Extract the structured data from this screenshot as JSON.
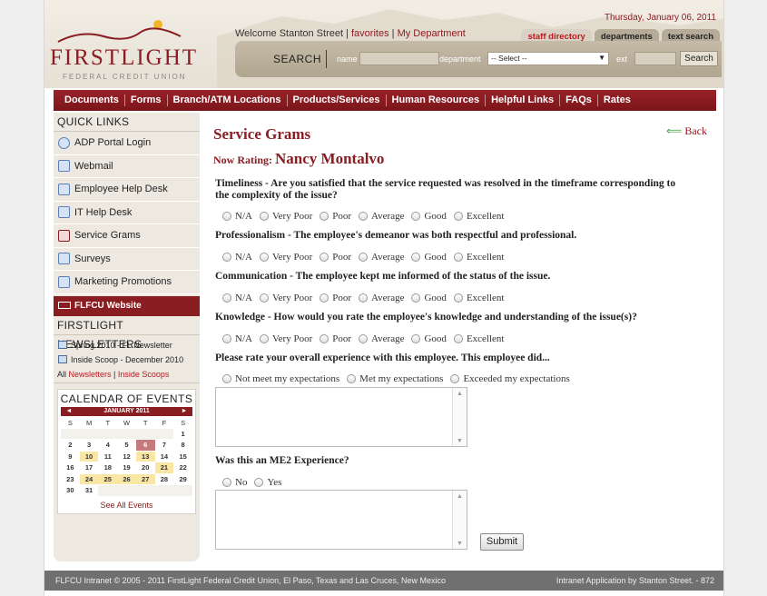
{
  "header": {
    "logo_text": "FIRSTLIGHT",
    "logo_sub": "FEDERAL CREDIT UNION",
    "welcome_prefix": "Welcome Stanton Street | ",
    "welcome_link1": "favorites",
    "welcome_sep": " | ",
    "welcome_link2": "My Department",
    "date": "Thursday, January 06, 2011",
    "tabs": [
      "staff directory",
      "departments",
      "text search"
    ],
    "search_label": "SEARCH",
    "name_label": "name",
    "department_label": "department",
    "department_value": "-- Select --",
    "ext_label": "ext",
    "search_button": "Search"
  },
  "nav": [
    "Documents",
    "Forms",
    "Branch/ATM Locations",
    "Products/Services",
    "Human Resources",
    "Helpful Links",
    "FAQs",
    "Rates"
  ],
  "sidebar": {
    "quick_links_title": "QUICK LINKS",
    "quick_links": [
      "ADP Portal Login",
      "Webmail",
      "Employee Help Desk",
      "IT Help Desk",
      "Service Grams",
      "Surveys",
      "Marketing Promotions"
    ],
    "website_label": "FLFCU Website",
    "newsletters_title": "FIRSTLIGHT NEWSLETTERS",
    "newsletters": [
      "Spring 2010 - FL Newsletter",
      "Inside Scoop - December 2010"
    ],
    "nl_all": "All ",
    "nl_link1": "Newsletters",
    "nl_sep": " | ",
    "nl_link2": "Inside Scoops",
    "calendar": {
      "title": "CALENDAR OF EVENTS",
      "month": "JANUARY 2011",
      "dow": [
        "S",
        "M",
        "T",
        "W",
        "T",
        "F",
        "S"
      ],
      "see_all": "See All Events"
    }
  },
  "content": {
    "title": "Service Grams",
    "back": "Back",
    "rating_label": "Now Rating: ",
    "rating_name": "Nancy Montalvo",
    "questions": [
      "Timeliness - Are you satisfied that the service requested was resolved in the timeframe corresponding to the complexity of the issue?",
      "Professionalism - The employee's demeanor was both respectful and professional.",
      "Communication - The employee kept me informed of the status of the issue.",
      "Knowledge - How would you rate the employee's knowledge and understanding of the issue(s)?"
    ],
    "rating_options": [
      "N/A",
      "Very Poor",
      "Poor",
      "Average",
      "Good",
      "Excellent"
    ],
    "overall_question": "Please rate your overall experience with this employee. This employee did...",
    "overall_options": [
      "Not meet my expectations",
      "Met my expectations",
      "Exceeded my expectations"
    ],
    "me2_question": "Was this an ME2 Experience?",
    "me2_options": [
      "No",
      "Yes"
    ],
    "submit": "Submit"
  },
  "footer": {
    "left": "FLFCU Intranet © 2005 - 2011 FirstLight Federal Credit Union, El Paso, Texas and Las Cruces, New Mexico",
    "right": "Intranet Application by Stanton Street. - 872"
  }
}
